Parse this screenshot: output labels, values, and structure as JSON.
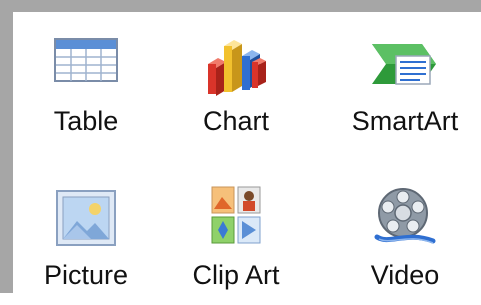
{
  "insert_gallery": {
    "items": [
      {
        "label": "Table",
        "icon": "table-icon"
      },
      {
        "label": "Chart",
        "icon": "chart-icon"
      },
      {
        "label": "SmartArt",
        "icon": "smartart-icon"
      },
      {
        "label": "Picture",
        "icon": "picture-icon"
      },
      {
        "label": "Clip Art",
        "icon": "clip-art-icon"
      },
      {
        "label": "Video",
        "icon": "video-icon"
      }
    ]
  },
  "colors": {
    "frame": "#a6a6a6",
    "text": "#111111",
    "table_header": "#5b8fd6",
    "chart_red": "#e03a2e",
    "chart_yellow": "#f2c12e",
    "chart_blue": "#2f6fd1",
    "smartart_green": "#2e9a3a"
  }
}
